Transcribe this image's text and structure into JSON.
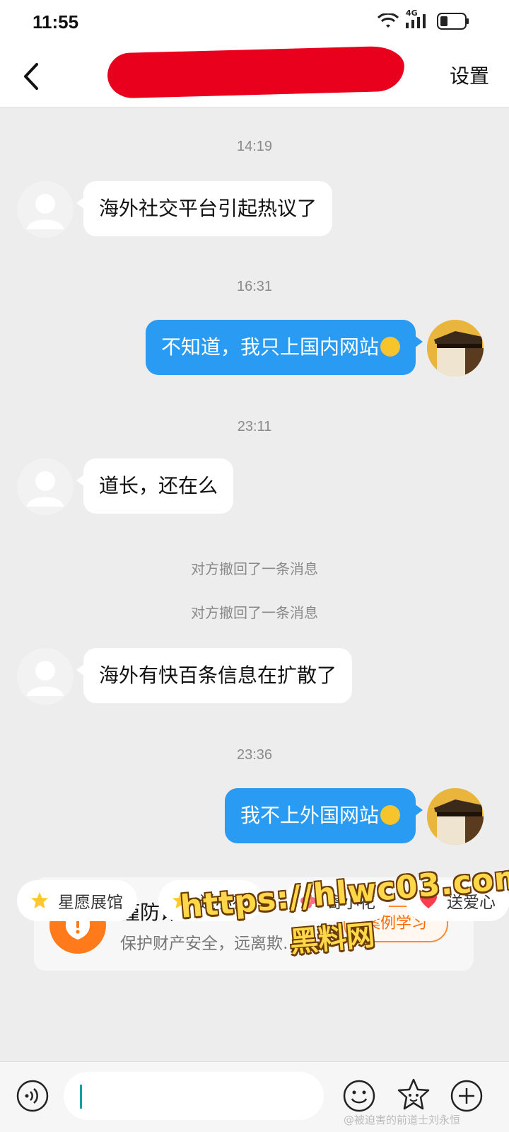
{
  "status_bar": {
    "time": "11:55",
    "network_label": "4G"
  },
  "header": {
    "settings_label": "设置"
  },
  "messages": [
    {
      "kind": "time",
      "text": "14:19"
    },
    {
      "kind": "incoming",
      "text": "海外社交平台引起热议了"
    },
    {
      "kind": "time",
      "text": "16:31"
    },
    {
      "kind": "outgoing",
      "text": "不知道，我只上国内网站",
      "emoji": "grinning-sweat-emoji"
    },
    {
      "kind": "time",
      "text": "23:11"
    },
    {
      "kind": "incoming",
      "text": "道长，还在么"
    },
    {
      "kind": "system",
      "text": "对方撤回了一条消息"
    },
    {
      "kind": "system",
      "text": "对方撤回了一条消息"
    },
    {
      "kind": "incoming",
      "text": "海外有快百条信息在扩散了"
    },
    {
      "kind": "time",
      "text": "23:36"
    },
    {
      "kind": "outgoing",
      "text": "我不上外国网站",
      "emoji": "laughing-tears-emoji"
    }
  ],
  "fraud_card": {
    "title": "谨防诈骗陷阱",
    "subtitle": "保护财产安全，远离欺…",
    "button_label": "案例学习",
    "icon": "shield-warning-icon",
    "accent": "#ff7a1a"
  },
  "chips": [
    {
      "label": "星愿展馆",
      "icon": "star-emoji-icon"
    },
    {
      "label": "送小花",
      "icon": "star-emoji-icon"
    },
    {
      "label": "寄小花",
      "icon": "flower-icon"
    },
    {
      "label": "送爱心",
      "icon": "heart-icon"
    }
  ],
  "watermark": {
    "url": "https://hlwc03.com",
    "name": "黑料网"
  },
  "input_bar": {
    "placeholder": ""
  },
  "credit": "@被迫害的前道士刘永恒",
  "colors": {
    "outgoing_bubble": "#2a9bf2",
    "background": "#ededed",
    "redaction": "#e8001c"
  }
}
